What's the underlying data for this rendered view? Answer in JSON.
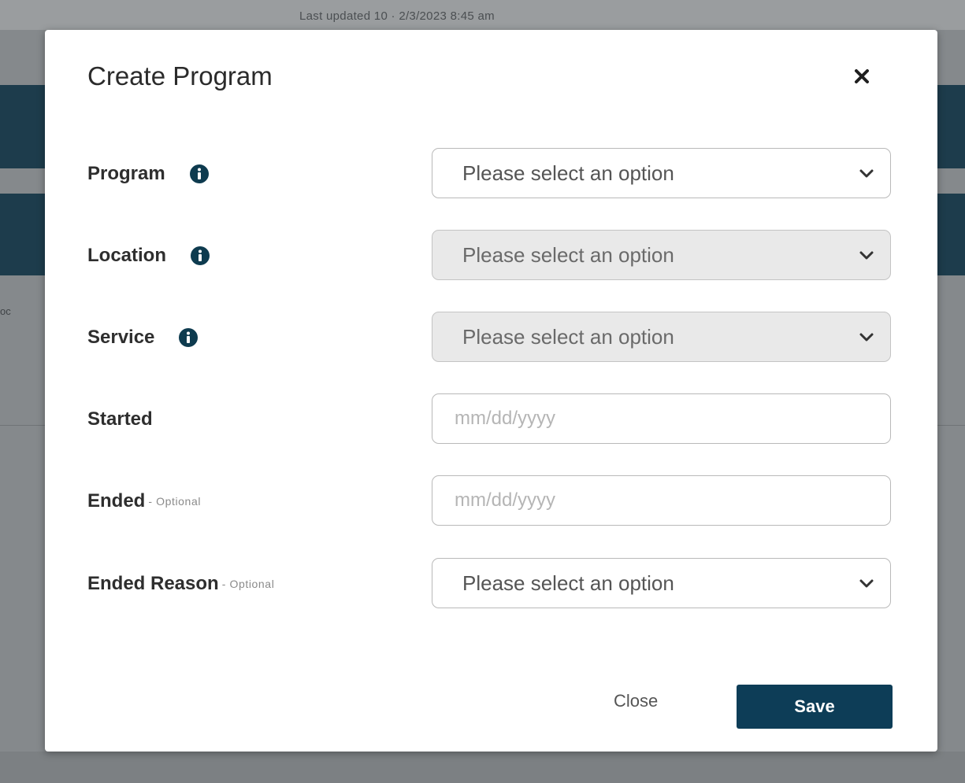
{
  "background": {
    "updated_text": "Last updated 10 · 2/3/2023 8:45 am",
    "left_clip_text": "oc"
  },
  "modal": {
    "title": "Create Program",
    "fields": [
      {
        "label": "Program",
        "optional": "",
        "has_info": true,
        "type": "select",
        "value": "Please select an option",
        "disabled": false
      },
      {
        "label": "Location",
        "optional": "",
        "has_info": true,
        "type": "select",
        "value": "Please select an option",
        "disabled": true
      },
      {
        "label": "Service",
        "optional": "",
        "has_info": true,
        "type": "select",
        "value": "Please select an option",
        "disabled": true
      },
      {
        "label": "Started",
        "optional": "",
        "has_info": false,
        "type": "date",
        "placeholder": "mm/dd/yyyy"
      },
      {
        "label": "Ended",
        "optional": " - Optional",
        "has_info": false,
        "type": "date",
        "placeholder": "mm/dd/yyyy"
      },
      {
        "label": "Ended Reason",
        "optional": " - Optional",
        "has_info": false,
        "type": "select",
        "value": "Please select an option",
        "disabled": false
      }
    ],
    "buttons": {
      "close_label": "Close",
      "save_label": "Save"
    }
  },
  "icons": {
    "close": "close-icon",
    "info": "info-icon",
    "chevron": "chevron-down-icon"
  },
  "colors": {
    "primary": "#0d3d57",
    "header_band": "#1d3c4c",
    "overlay": "#85898c"
  }
}
